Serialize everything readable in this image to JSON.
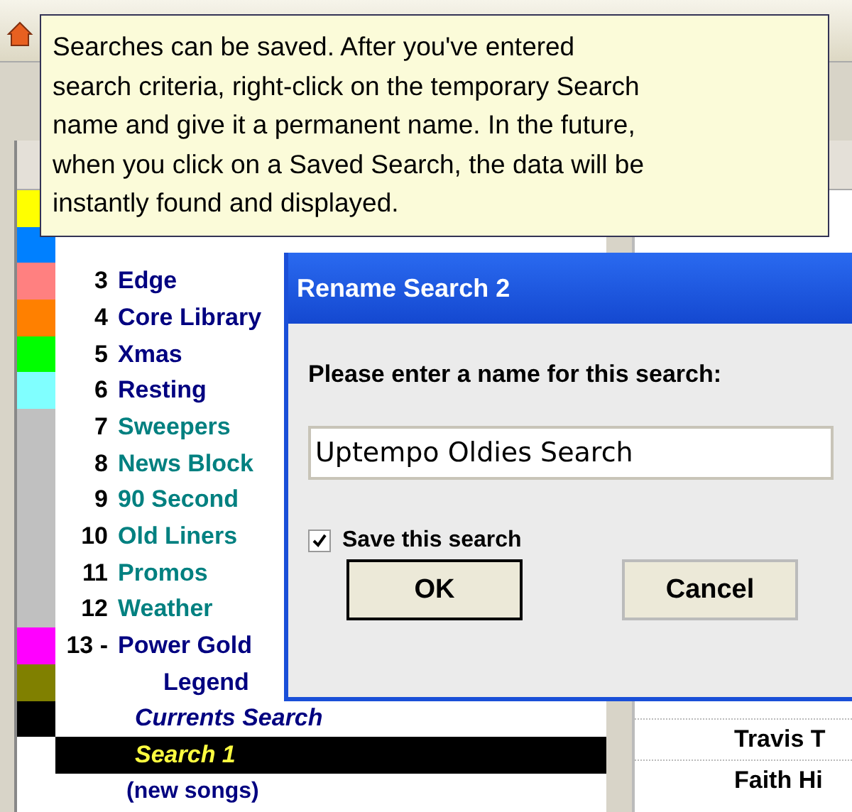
{
  "tooltip": {
    "text": "Searches can be saved. After you've entered\nsearch criteria, right-click on the temporary Search\nname and give it a permanent name. In the future,\nwhen you click on a Saved Search, the data will be\ninstantly found and displayed."
  },
  "list": [
    {
      "color": "#ffff00"
    },
    {
      "color": "#0080ff"
    },
    {
      "number": "3",
      "name": "Edge",
      "kind": "music",
      "color": "#ff8080",
      "selected": false
    },
    {
      "number": "4",
      "name": "Core Library",
      "kind": "music",
      "color": "#ff8000",
      "selected": false
    },
    {
      "number": "5",
      "name": "Xmas",
      "kind": "music",
      "color": "#00ff00",
      "selected": false
    },
    {
      "number": "6",
      "name": "Resting",
      "kind": "music",
      "color": "#80ffff",
      "selected": false
    },
    {
      "number": "7",
      "name": "Sweepers",
      "kind": "spot",
      "color": "#c0c0c0",
      "selected": false
    },
    {
      "number": "8",
      "name": "News Block",
      "kind": "spot",
      "color": "#c0c0c0",
      "selected": false
    },
    {
      "number": "9",
      "name": "90 Second",
      "kind": "spot",
      "color": "#c0c0c0",
      "selected": false
    },
    {
      "number": "10",
      "name": "Old Liners",
      "kind": "spot",
      "color": "#c0c0c0",
      "selected": false
    },
    {
      "number": "11",
      "name": "Promos",
      "kind": "spot",
      "color": "#c0c0c0",
      "selected": false
    },
    {
      "number": "12",
      "name": "Weather",
      "kind": "spot",
      "color": "#c0c0c0",
      "selected": false
    },
    {
      "number": "13 -",
      "name": "Power Gold",
      "kind": "music",
      "color": "#ff00ff",
      "selected": false
    },
    {
      "name": "Legend",
      "kind": "legend",
      "color": "#808000",
      "selected": false
    },
    {
      "name": "Currents Search",
      "kind": "search",
      "color": "#000000",
      "selected": false
    },
    {
      "name": "Search 1",
      "kind": "search",
      "selected": true
    },
    {
      "name": "(new songs)",
      "kind": "new",
      "selected": false
    }
  ],
  "artists": [
    "Travis T",
    "Faith Hi"
  ],
  "dialog": {
    "title": "Rename Search 2",
    "prompt": "Please enter a name for this search:",
    "value": "Uptempo Oldies Search",
    "checkbox": {
      "label": "Save this search",
      "checked": true
    },
    "buttons": [
      {
        "label": "OK",
        "default": true
      },
      {
        "label": "Cancel",
        "default": false
      }
    ]
  }
}
